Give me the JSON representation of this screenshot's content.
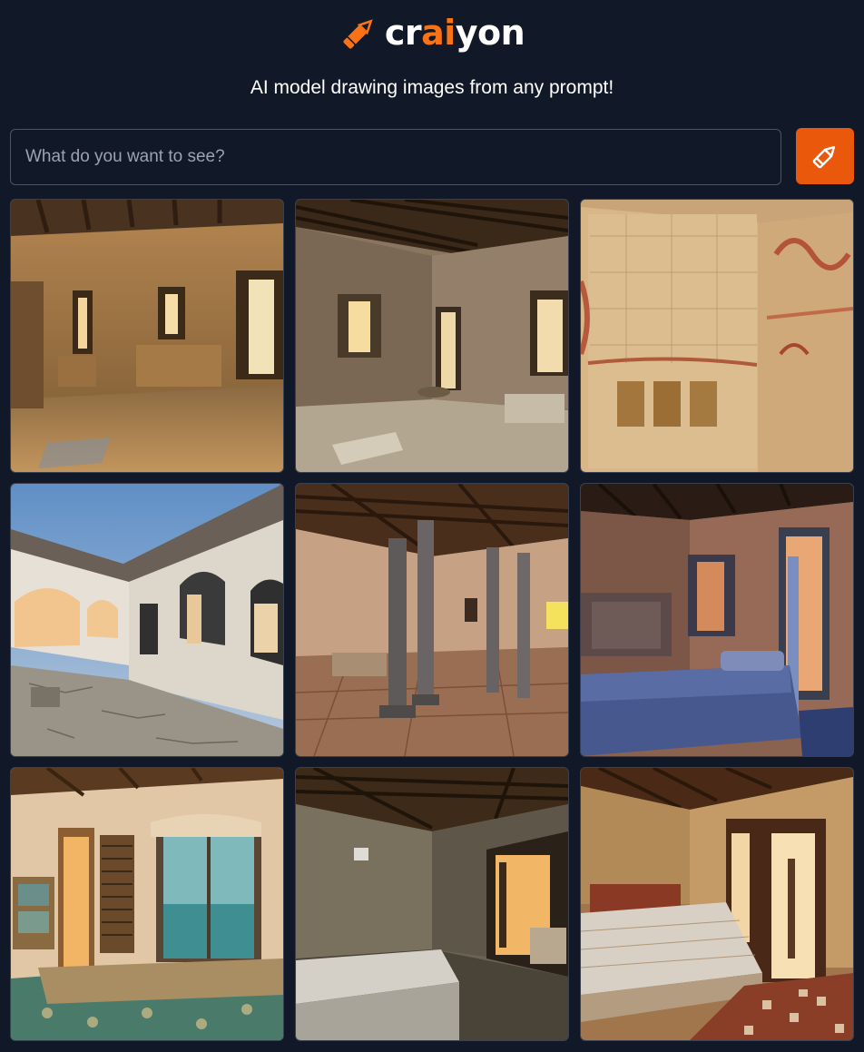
{
  "header": {
    "logo_icon": "pencil-icon",
    "brand": {
      "part1": "cr",
      "part2": "ai",
      "part3": "yon"
    },
    "tagline": "AI model drawing images from any prompt!"
  },
  "search": {
    "placeholder": "What do you want to see?",
    "value": "",
    "submit_icon": "pencil-icon"
  },
  "colors": {
    "background": "#111827",
    "accent": "#ea580c",
    "brand_accent": "#f97316",
    "input_border": "#4b5563"
  },
  "results": [
    {
      "scene": "stone-hall-with-windows"
    },
    {
      "scene": "stone-room-beamed-ceiling"
    },
    {
      "scene": "frescoed-wall-room"
    },
    {
      "scene": "open-terrace-with-arches"
    },
    {
      "scene": "columned-hall"
    },
    {
      "scene": "bedroom-with-blue-bed"
    },
    {
      "scene": "bedroom-with-sea-view-door"
    },
    {
      "scene": "cave-bedroom"
    },
    {
      "scene": "bedroom-with-patterned-rug"
    }
  ]
}
